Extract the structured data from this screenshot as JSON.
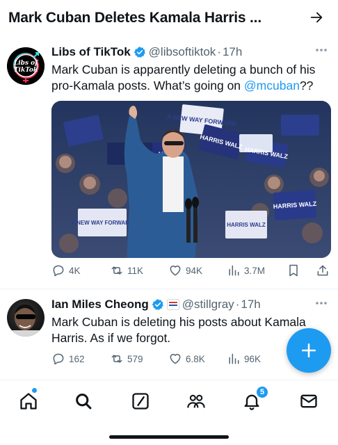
{
  "header": {
    "title": "Mark Cuban Deletes Kamala Harris ..."
  },
  "tweets": [
    {
      "display_name": "Libs of TikTok",
      "handle": "@libsoftiktok",
      "separator": "·",
      "time": "17h",
      "text_before": "Mark Cuban is apparently deleting a bunch of his pro-Kamala posts. What’s going on ",
      "mention": "@mcuban",
      "text_after": "??",
      "avatar_text_1": "Libs of",
      "avatar_text_2": "TikTok",
      "media_signs": [
        "HARRIS WALZ",
        "A NEW WAY FORWARD",
        "HARRIS WALZ",
        "vote",
        "HARRIS WALZ",
        "A NEW WAY FORWARD",
        "HARRIS WALZ"
      ],
      "stats": {
        "replies": "4K",
        "reposts": "11K",
        "likes": "94K",
        "views": "3.7M"
      }
    },
    {
      "display_name": "Ian Miles Cheong",
      "handle": "@stillgray",
      "separator": "·",
      "time": "17h",
      "text": "Mark Cuban is deleting his posts about Kamala Harris. As if we forgot.",
      "stats": {
        "replies": "162",
        "reposts": "579",
        "likes": "6.8K",
        "views": "96K"
      }
    }
  ],
  "tabbar": {
    "notifications_badge": "5"
  },
  "colors": {
    "accent": "#1d9bf0",
    "text": "#0f1419",
    "secondary": "#536471"
  }
}
